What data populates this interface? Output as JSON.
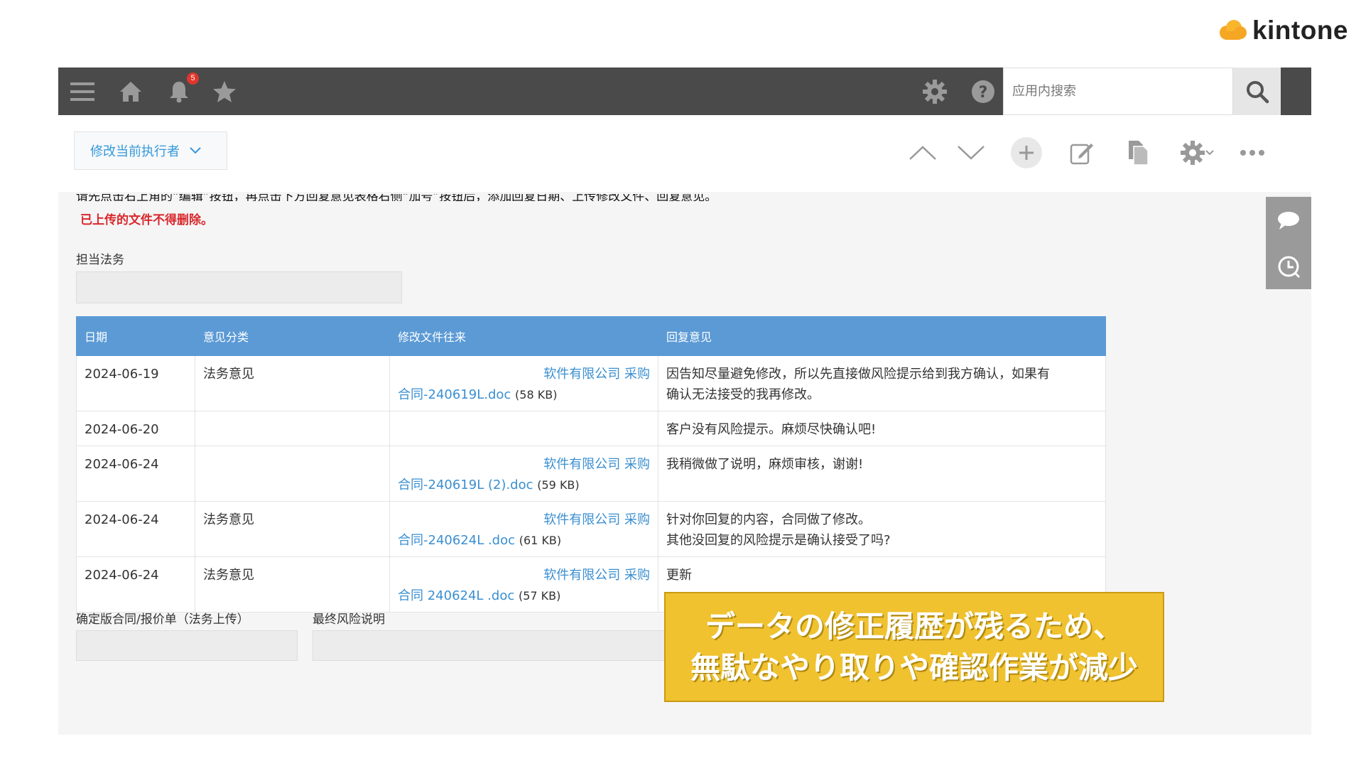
{
  "logo": {
    "text": "kintone",
    "icon": "kintone-cloud-logo"
  },
  "header": {
    "notification_count": "5",
    "search_placeholder": "应用内搜索",
    "icons": [
      "menu-icon",
      "home-icon",
      "bell-icon",
      "star-icon",
      "gear-icon",
      "help-icon",
      "search-icon"
    ]
  },
  "toolbar": {
    "assignee_button": "修改当前执行者",
    "icons": [
      "chevron-up-icon",
      "chevron-down-icon",
      "add-icon",
      "edit-icon",
      "copy-icon",
      "settings-icon",
      "more-icon"
    ]
  },
  "record": {
    "instruction_partial": "请先点击右上角的“编辑”按钮，再点击下方回复意见表格右侧“加号”按钮后，添加回复日期、上传修改文件、回复意见。",
    "warning": "已上传的文件不得删除。",
    "legal_label": "担当法务",
    "table": {
      "headers": [
        "日期",
        "意见分类",
        "修改文件往来",
        "回复意见"
      ],
      "rows": [
        {
          "date": "2024-06-19",
          "category": "法务意见",
          "file_line1": "软件有限公司 采购",
          "file_line2": "合同-240619L.doc",
          "file_size": "(58 KB)",
          "reply_line1": "因告知尽量避免修改，所以先直接做风险提示给到我方确认，如果有",
          "reply_line2": "确认无法接受的我再修改。"
        },
        {
          "date": "2024-06-20",
          "category": "",
          "file_line1": "",
          "file_line2": "",
          "file_size": "",
          "reply_line1": "客户没有风险提示。麻烦尽快确认吧!",
          "reply_line2": ""
        },
        {
          "date": "2024-06-24",
          "category": "",
          "file_line1": "软件有限公司 采购",
          "file_line2": "合同-240619L (2).doc",
          "file_size": "(59 KB)",
          "reply_line1": "我稍微做了说明，麻烦审核，谢谢!",
          "reply_line2": ""
        },
        {
          "date": "2024-06-24",
          "category": "法务意见",
          "file_line1": "软件有限公司 采购",
          "file_line2": "合同-240624L .doc",
          "file_size": "(61 KB)",
          "reply_line1": "针对你回复的内容，合同做了修改。",
          "reply_line2": "其他没回复的风险提示是确认接受了吗?"
        },
        {
          "date": "2024-06-24",
          "category": "法务意见",
          "file_line1": "软件有限公司 采购",
          "file_line2": "合同 240624L .doc",
          "file_size": "(57 KB)",
          "reply_line1": "更新",
          "reply_line2": ""
        }
      ]
    },
    "final_contract_label": "确定版合同/报价单（法务上传）",
    "final_risk_label": "最终风险说明"
  },
  "sidepanel": {
    "icons": [
      "comment-icon",
      "history-icon"
    ]
  },
  "callout": {
    "line1": "データの修正履歴が残るため、",
    "line2": "無駄なやり取りや確認作業が減少"
  },
  "colors": {
    "topbar": "#4a4a4a",
    "table_header": "#5b9ad5",
    "link": "#3a8fd0",
    "warning": "#d8282d",
    "callout": "#f0c230"
  }
}
